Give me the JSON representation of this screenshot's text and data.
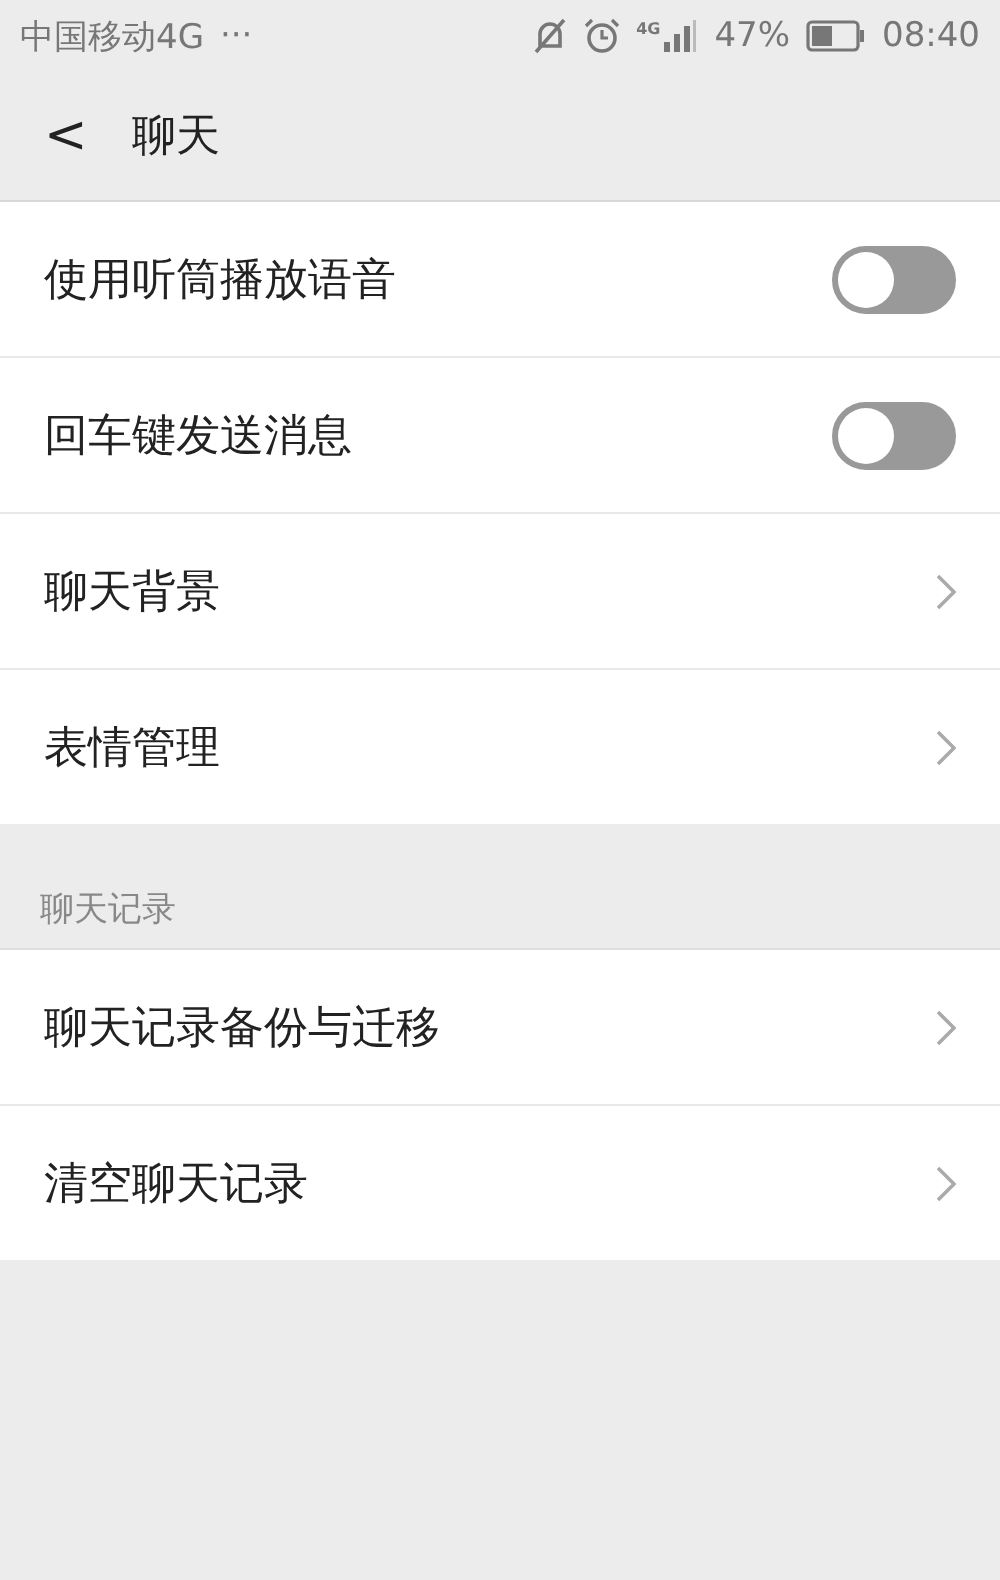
{
  "status_bar": {
    "carrier": "中国移动4G",
    "more": "···",
    "network": "4G",
    "battery": "47%",
    "time": "08:40"
  },
  "nav": {
    "back": "<",
    "title": "聊天"
  },
  "sections": [
    {
      "items": [
        {
          "kind": "toggle",
          "label": "使用听筒播放语音",
          "on": false
        },
        {
          "kind": "toggle",
          "label": "回车键发送消息",
          "on": false
        },
        {
          "kind": "link",
          "label": "聊天背景"
        },
        {
          "kind": "link",
          "label": "表情管理"
        }
      ]
    },
    {
      "header": "聊天记录",
      "items": [
        {
          "kind": "link",
          "label": "聊天记录备份与迁移"
        },
        {
          "kind": "link",
          "label": "清空聊天记录"
        }
      ]
    }
  ]
}
